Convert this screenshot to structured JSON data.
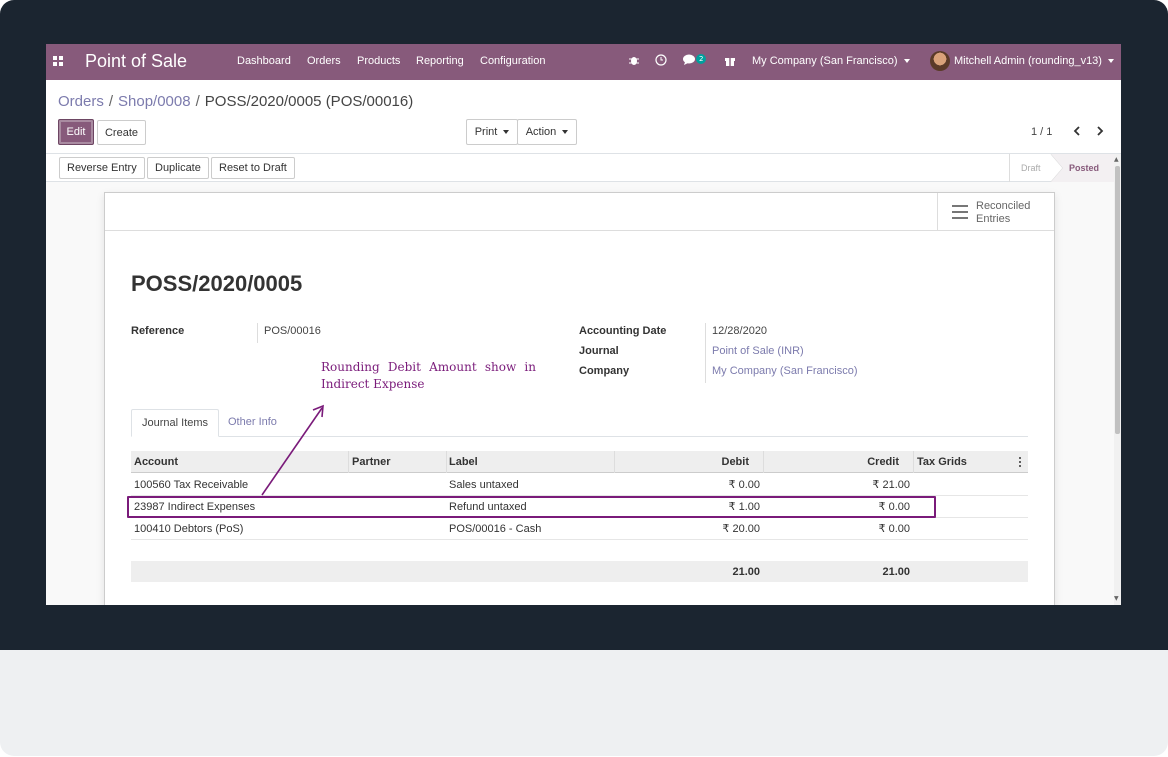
{
  "navbar": {
    "app_title": "Point of Sale",
    "menu": [
      "Dashboard",
      "Orders",
      "Products",
      "Reporting",
      "Configuration"
    ],
    "chat_badge": "2",
    "company": "My Company (San Francisco)",
    "user": "Mitchell Admin (rounding_v13)",
    "icons": [
      "apps-icon",
      "bug-icon",
      "clock-icon",
      "chat-icon",
      "gift-icon"
    ]
  },
  "breadcrumb": {
    "items": [
      "Orders",
      "Shop/0008"
    ],
    "current": "POSS/2020/0005 (POS/00016)"
  },
  "control": {
    "edit": "Edit",
    "create": "Create",
    "print": "Print",
    "action": "Action",
    "pager": "1 / 1"
  },
  "statusbar": {
    "buttons": [
      "Reverse Entry",
      "Duplicate",
      "Reset to Draft"
    ],
    "stages": [
      "Draft",
      "Posted"
    ],
    "active_stage": "Posted"
  },
  "sheet": {
    "stat_button": "Reconciled Entries",
    "title": "POSS/2020/0005",
    "reference_label": "Reference",
    "reference_value": "POS/00016",
    "accounting_date_label": "Accounting Date",
    "accounting_date_value": "12/28/2020",
    "journal_label": "Journal",
    "journal_value": "Point of Sale (INR)",
    "company_label": "Company",
    "company_value": "My Company (San Francisco)"
  },
  "annotation": "Rounding Debit Amount show in Indirect Expense",
  "tabs": [
    "Journal Items",
    "Other Info"
  ],
  "table": {
    "headers": [
      "Account",
      "Partner",
      "Label",
      "Debit",
      "Credit",
      "Tax Grids"
    ],
    "rows": [
      {
        "account": "100560 Tax Receivable",
        "partner": "",
        "label": "Sales untaxed",
        "debit": "₹ 0.00",
        "credit": "₹ 21.00",
        "tax": ""
      },
      {
        "account": "23987 Indirect Expenses",
        "partner": "",
        "label": "Refund untaxed",
        "debit": "₹ 1.00",
        "credit": "₹ 0.00",
        "tax": ""
      },
      {
        "account": "100410 Debtors (PoS)",
        "partner": "",
        "label": "POS/00016 - Cash",
        "debit": "₹ 20.00",
        "credit": "₹ 0.00",
        "tax": ""
      }
    ],
    "total_debit": "21.00",
    "total_credit": "21.00"
  },
  "colors": {
    "brand": "#875a7b",
    "link": "#7c7bad",
    "annotation": "#7a1b7a",
    "badge": "#00a09d"
  }
}
